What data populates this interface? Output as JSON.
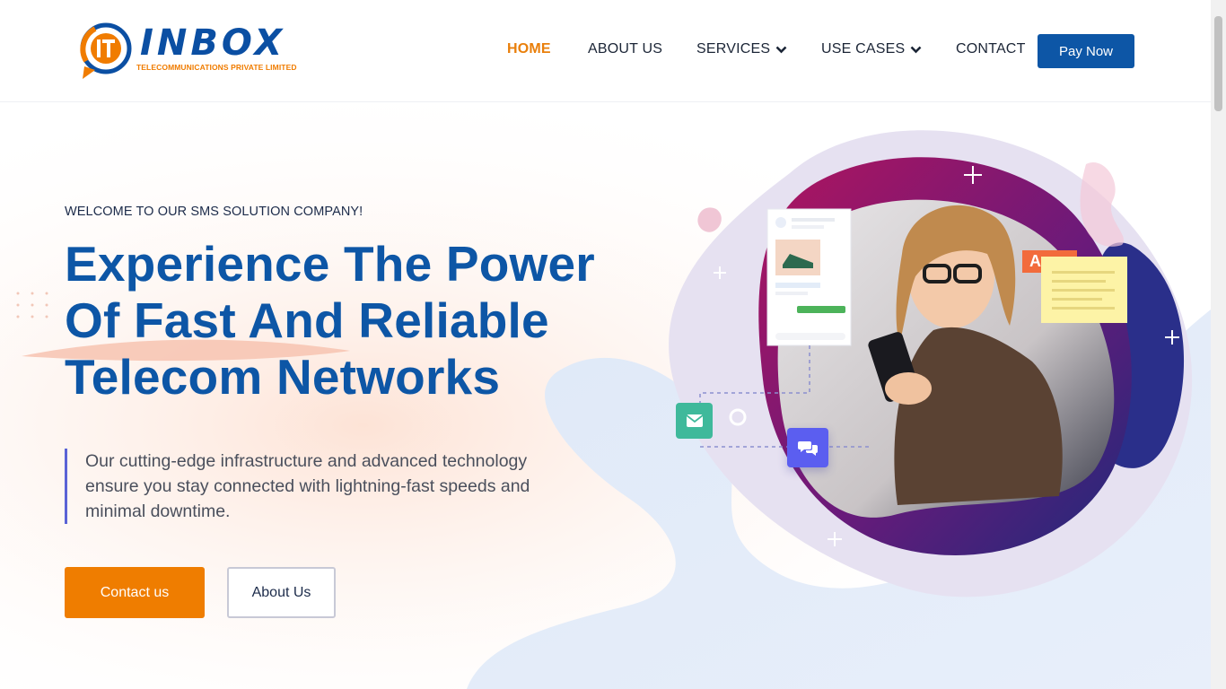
{
  "brand": {
    "logo_word": "INBOX",
    "logo_subtitle": "TELECOMMUNICATIONS PRIVATE LIMITED",
    "accent_orange": "#ef7d00",
    "brand_blue": "#0d56a6"
  },
  "nav": {
    "items": [
      {
        "label": "HOME",
        "active": true
      },
      {
        "label": "ABOUT US"
      },
      {
        "label": "SERVICES",
        "has_dropdown": true
      },
      {
        "label": "USE CASES",
        "has_dropdown": true
      },
      {
        "label": "CONTACT"
      }
    ],
    "pay_label": "Pay Now"
  },
  "hero": {
    "welcome": "WELCOME TO OUR SMS SOLUTION COMPANY!",
    "headline": "Experience The Power Of Fast And Reliable Telecom Networks",
    "description": "Our cutting-edge infrastructure and advanced technology ensure you stay connected with lightning-fast speeds and minimal downtime.",
    "contact_label": "Contact us",
    "about_label": "About Us",
    "tag_name": "Anne"
  },
  "icons": [
    "envelope-icon",
    "chat-icon",
    "chevron-down-icon"
  ]
}
